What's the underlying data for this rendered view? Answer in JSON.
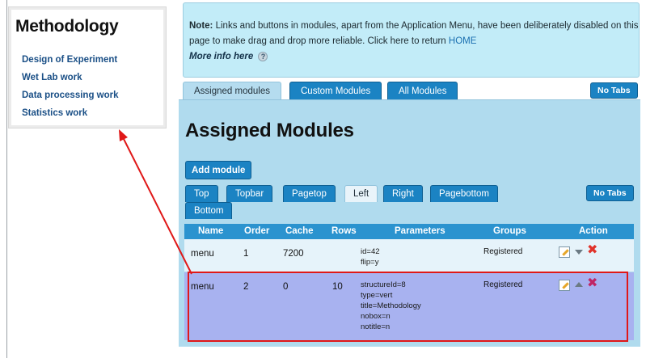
{
  "methodology": {
    "title": "Methodology",
    "links": [
      "Design of Experiment",
      "Wet Lab work",
      "Data processing work",
      "Statistics work"
    ]
  },
  "note": {
    "label": "Note:",
    "text": "Links and buttons in modules, apart from the Application Menu, have been deliberately disabled on this page to make drag and drop more reliable. Click here to return",
    "home_link": "HOME",
    "more_info": "More info here",
    "help_icon_glyph": "?"
  },
  "top_tabs": {
    "assigned": "Assigned modules",
    "custom": "Custom Modules",
    "all": "All Modules",
    "no_tabs": "No Tabs"
  },
  "panel": {
    "title": "Assigned Modules",
    "add_button": "Add module",
    "no_tabs": "No Tabs"
  },
  "position_tabs": {
    "top": "Top",
    "topbar": "Topbar",
    "pagetop": "Pagetop",
    "left": "Left",
    "right": "Right",
    "pagebottom": "Pagebottom",
    "bottom": "Bottom",
    "active": "Left"
  },
  "table": {
    "headers": {
      "name": "Name",
      "order": "Order",
      "cache": "Cache",
      "rows": "Rows",
      "parameters": "Parameters",
      "groups": "Groups",
      "action": "Action"
    },
    "rows": [
      {
        "name": "menu",
        "order": "1",
        "cache": "7200",
        "rows": "",
        "params": [
          "id=42",
          "flip=y"
        ],
        "groups": "Registered",
        "delete_glyph": "✖"
      },
      {
        "name": "menu",
        "order": "2",
        "cache": "0",
        "rows": "10",
        "params": [
          "structureId=8",
          "type=vert",
          "title=Methodology",
          "nobox=n",
          "notitle=n"
        ],
        "groups": "Registered",
        "delete_glyph": "✖"
      }
    ]
  },
  "colors": {
    "accent": "#1b83c3",
    "panel": "#b0dbee",
    "note_bg": "#c2ecf8",
    "highlight": "#e01818",
    "selected_row": "#a8b2f0"
  }
}
